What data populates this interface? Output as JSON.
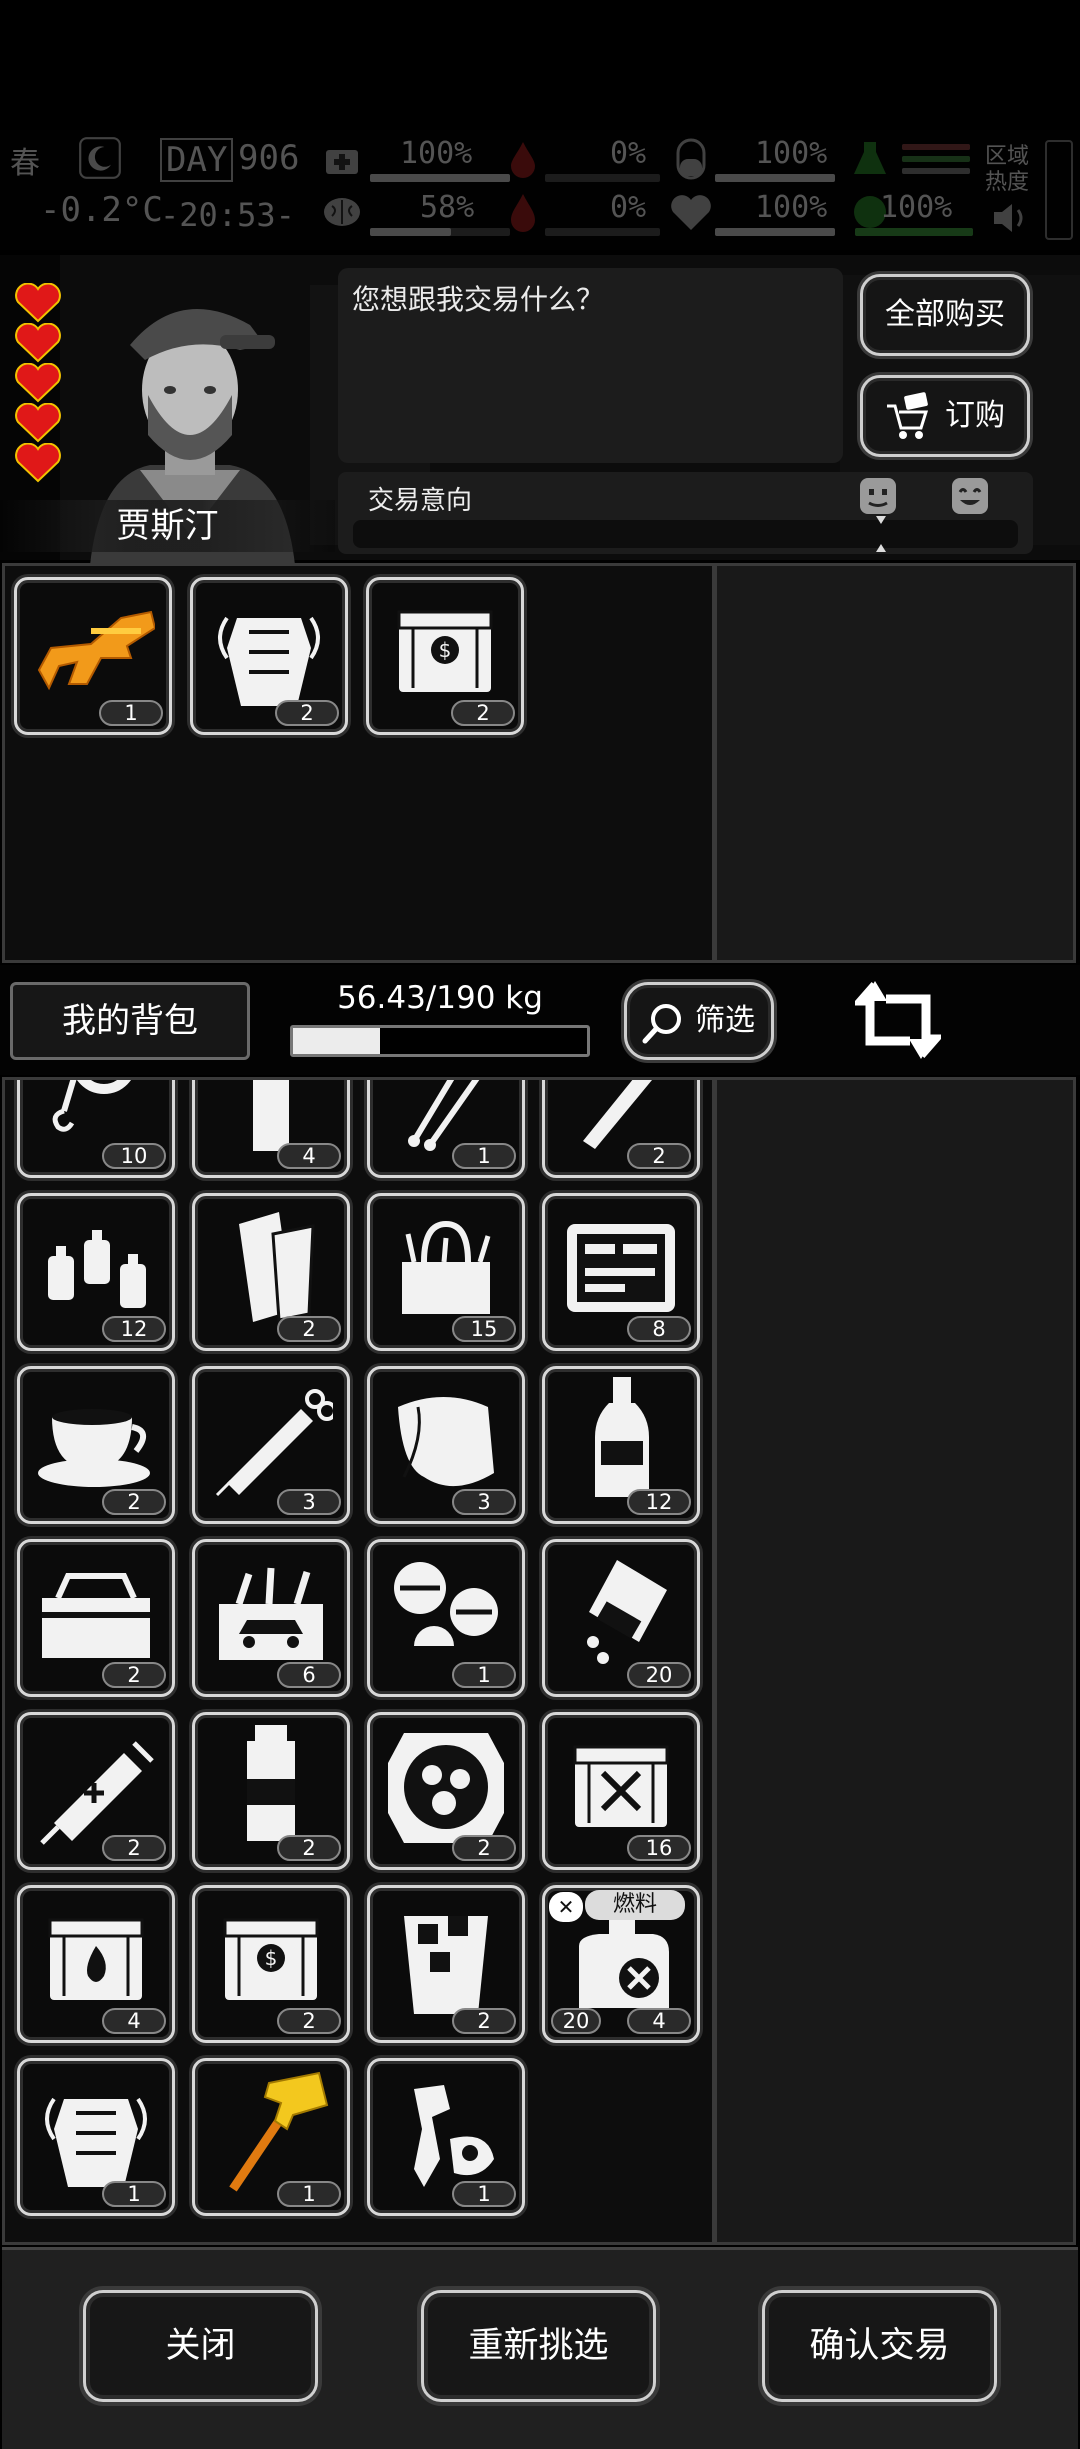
{
  "hud": {
    "season": "春",
    "day_label": "DAY",
    "day": "906",
    "temperature": "-0.2°C",
    "clock": "-20:53-",
    "stats": [
      {
        "icon": "medkit-icon",
        "value": "100%"
      },
      {
        "icon": "blood-icon",
        "value": "0%"
      },
      {
        "icon": "pill-icon",
        "value": "100%"
      },
      {
        "icon": "radiation-icon",
        "value": ""
      },
      {
        "icon": "brain-icon",
        "value": "58%"
      },
      {
        "icon": "infection-icon",
        "value": "0%"
      },
      {
        "icon": "heart-icon",
        "value": "100%"
      },
      {
        "icon": "stamina-icon",
        "value": "100%"
      }
    ],
    "zone_heat": "区域\n热度"
  },
  "npc": {
    "name": "贾斯汀",
    "hearts": 5,
    "dialog": "您想跟我交易什么？",
    "buy_all": "全部购买",
    "order": "订购",
    "intent_label": "交易意向"
  },
  "merchant_items": [
    {
      "icon": "orange-rifle-icon",
      "count": "1"
    },
    {
      "icon": "body-armor-icon",
      "count": "2"
    },
    {
      "icon": "supply-crate-icon",
      "count": "2"
    }
  ],
  "bag": {
    "title": "我的背包",
    "weight": "56.43/190 kg",
    "weight_fraction": 0.297,
    "filter": "筛选",
    "items": [
      {
        "icon": "rope-icon",
        "count": "10"
      },
      {
        "icon": "bottle-icon",
        "count": "4"
      },
      {
        "icon": "wires-icon",
        "count": "1"
      },
      {
        "icon": "pen-icon",
        "count": "2"
      },
      {
        "icon": "spray-cans-icon",
        "count": "12"
      },
      {
        "icon": "paper-rolls-icon",
        "count": "2"
      },
      {
        "icon": "tool-bag-icon",
        "count": "15"
      },
      {
        "icon": "toolkit-case-icon",
        "count": "8"
      },
      {
        "icon": "coffee-cup-icon",
        "count": "2"
      },
      {
        "icon": "syringe-icon",
        "count": "3"
      },
      {
        "icon": "cloth-icon",
        "count": "3"
      },
      {
        "icon": "liquor-bottle-icon",
        "count": "12"
      },
      {
        "icon": "toolbox-icon",
        "count": "2"
      },
      {
        "icon": "car-repair-kit-icon",
        "count": "6"
      },
      {
        "icon": "pills-icon",
        "count": "1"
      },
      {
        "icon": "pill-bottle-icon",
        "count": "20"
      },
      {
        "icon": "medical-injector-icon",
        "count": "2"
      },
      {
        "icon": "water-flask-icon",
        "count": "2"
      },
      {
        "icon": "hotpot-icon",
        "count": "2"
      },
      {
        "icon": "weapon-crate-icon",
        "count": "16"
      },
      {
        "icon": "fire-crate-icon",
        "count": "4"
      },
      {
        "icon": "supply-crate-icon",
        "count": "2"
      },
      {
        "icon": "iced-drink-icon",
        "count": "2"
      },
      {
        "icon": "fuel-canister-icon",
        "count": "4",
        "count_left": "20",
        "tag": "燃料"
      },
      {
        "icon": "body-armor-icon",
        "count": "1"
      },
      {
        "icon": "golden-hammer-icon",
        "count": "1"
      },
      {
        "icon": "scrap-parts-icon",
        "count": "1"
      }
    ]
  },
  "footer": {
    "close": "关闭",
    "reselect": "重新挑选",
    "confirm": "确认交易"
  }
}
